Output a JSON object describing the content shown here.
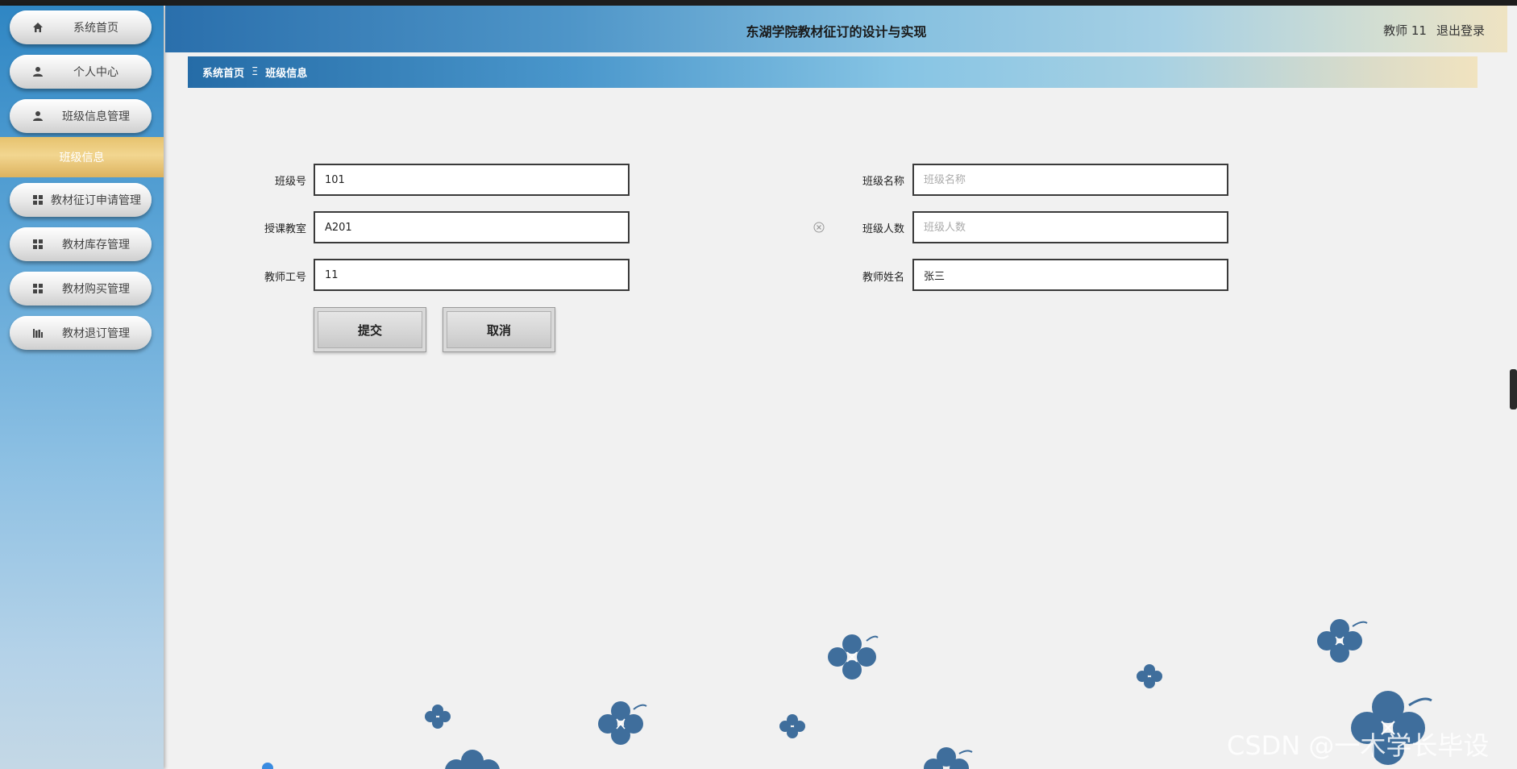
{
  "header": {
    "title": "东湖学院教材征订的设计与实现",
    "user": "教师 11",
    "logout": "退出登录"
  },
  "sidebar": {
    "items": [
      {
        "label": "系统首页",
        "icon": "home-icon"
      },
      {
        "label": "个人中心",
        "icon": "user-icon"
      },
      {
        "label": "班级信息管理",
        "icon": "user-icon"
      },
      {
        "label": "教材征订申请管理",
        "icon": "grid-icon"
      },
      {
        "label": "教材库存管理",
        "icon": "grid-icon"
      },
      {
        "label": "教材购买管理",
        "icon": "grid-icon"
      },
      {
        "label": "教材退订管理",
        "icon": "bar-chart-icon"
      }
    ],
    "active_sub": "班级信息"
  },
  "breadcrumb": {
    "home": "系统首页",
    "separator": "Ξ",
    "current": "班级信息"
  },
  "form": {
    "class_no": {
      "label": "班级号",
      "value": "101"
    },
    "class_name": {
      "label": "班级名称",
      "value": "",
      "placeholder": "班级名称"
    },
    "classroom": {
      "label": "授课教室",
      "value": "A201"
    },
    "class_size": {
      "label": "班级人数",
      "value": "",
      "placeholder": "班级人数"
    },
    "teacher_id": {
      "label": "教师工号",
      "value": "11"
    },
    "teacher_name": {
      "label": "教师姓名",
      "value": "张三"
    },
    "submit": "提交",
    "cancel": "取消"
  },
  "watermark": "CSDN @一木学长毕设",
  "colors": {
    "accent": "#2f86c3",
    "active": "#e6c26e",
    "flower": "#3f6e9c"
  }
}
